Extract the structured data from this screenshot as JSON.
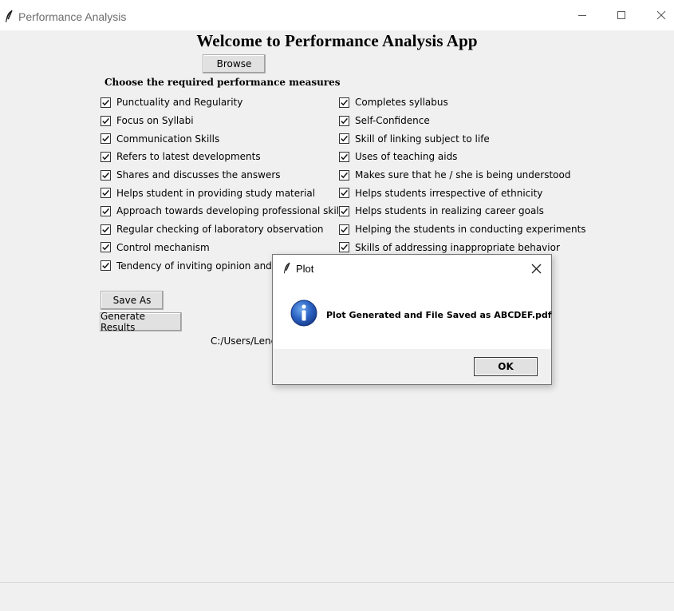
{
  "window": {
    "title": "Performance Analysis",
    "icon": "feather-icon"
  },
  "main": {
    "heading": "Welcome to Performance Analysis App",
    "browse_label": "Browse",
    "measures_label": "Choose the required performance measures",
    "measures_left": [
      {
        "label": "Punctuality and Regularity",
        "checked": true
      },
      {
        "label": "Focus on Syllabi",
        "checked": true
      },
      {
        "label": "Communication Skills",
        "checked": true
      },
      {
        "label": "Refers to latest developments",
        "checked": true
      },
      {
        "label": "Shares and discusses the answers",
        "checked": true
      },
      {
        "label": "Helps student in providing study material",
        "checked": true
      },
      {
        "label": "Approach towards developing professional skills",
        "checked": true
      },
      {
        "label": "Regular checking of laboratory observation",
        "checked": true
      },
      {
        "label": "Control mechanism",
        "checked": true
      },
      {
        "label": "Tendency of inviting opinion and q",
        "checked": true
      }
    ],
    "measures_right": [
      {
        "label": "Completes syllabus",
        "checked": true
      },
      {
        "label": "Self-Confidence",
        "checked": true
      },
      {
        "label": "Skill of linking subject to life",
        "checked": true
      },
      {
        "label": "Uses of teaching aids",
        "checked": true
      },
      {
        "label": "Makes sure that he / she is being understood",
        "checked": true
      },
      {
        "label": "Helps students irrespective of ethnicity",
        "checked": true
      },
      {
        "label": "Helps students in realizing career goals",
        "checked": true
      },
      {
        "label": "Helping the students in conducting experiments",
        "checked": true
      },
      {
        "label": "Skills of addressing inappropriate behavior",
        "checked": true
      }
    ],
    "save_as_label": "Save As",
    "generate_label": "Generate Results",
    "path_text": "C:/Users/Lenc"
  },
  "dialog": {
    "title": "Plot",
    "icon": "info-icon",
    "message": "Plot Generated and File Saved as ABCDEF.pdf",
    "ok_label": "OK"
  }
}
